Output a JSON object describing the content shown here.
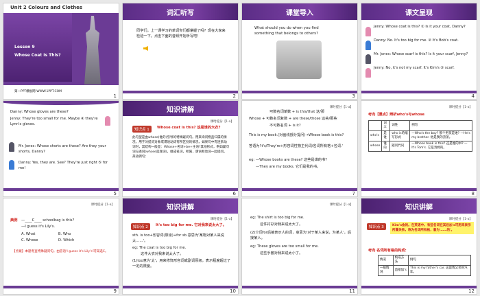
{
  "slides": [
    {
      "num": "1",
      "unit": "Unit 2 Colours and Clothes",
      "lesson": "Lesson 9",
      "title": "Whose Coat Is This?",
      "footer": "第一PPT模板网-WWW.1PPT.COM"
    },
    {
      "num": "2",
      "heading": "词汇听写",
      "body": "同学们，上一课学习的单词你们都掌握了吗？现在大家来检验一下。点击下面的音频开始听写吧！"
    },
    {
      "num": "3",
      "heading": "课堂导入",
      "body": "What should you do when you find something that belongs to others?"
    },
    {
      "num": "4",
      "heading": "课文呈现",
      "lines": [
        "Jenny: Whose coat is this? ① Is it your coat, Danny?",
        "Danny: No. It's too big for me. ② It's Bob's coat.",
        "Mr. Jones: Whose scarf is this? Is it your scarf, Jenny?",
        "Jenny: No, it's not my scarf. It's Kim's ③ scarf."
      ]
    },
    {
      "num": "5",
      "lines": [
        "Danny: Whose gloves are these?",
        "Jenny: They're too small for me. Maybe ④ they're Lynn's gloves.",
        "Mr. Jones: Whose shorts are these? Are they your shorts, Danny?",
        "Danny: Yes, they are. See? They're just right ⑤ for me!"
      ]
    },
    {
      "num": "6",
      "heading": "知识讲解",
      "tag": "课时提分【1-a】",
      "point": "知识点 1",
      "point_title": "Whose coat is this? 这是谁的大衣?",
      "body": "此句型是由whose(谁的)引导的特殊疑问句。用来询问物品归属的情况，用于对提问对象或谓语动词有所区别的情况，如果句中有连系动词时，其结构一般是：Whose+名词+be+主语?其他形式，例如疑问词与连词(whose是连词)，组成名词，所属，谓语和动词一起提问。英语例句："
    },
    {
      "num": "7",
      "tag": "课时提分【1-a】",
      "lines": [
        "可数名词单数 + is this/that 这/那",
        "Whose + 可数名词复数 + are these/those 这些/那些",
        "不可数名词 + is it?",
        "This is my book.(对画线部分提问)→Whose book is this?",
        "答语为'It's/They're+形容词性物主代词/名词所有格+名词.'",
        "eg: —Whose books are these? 这些是谁的书?",
        "—They are my books. 它们是我的书。"
      ]
    },
    {
      "num": "8",
      "tag": "课时提分【1-a】",
      "head": "考向【重点】辨析who's与whose",
      "table_headers": [
        "",
        "词义",
        "词性",
        "例句"
      ],
      "rows": [
        [
          "who's",
          "是谁",
          "who is的缩写形式",
          "—Who's the boy? 那个男孩是谁? —He's my brother. 他是我的弟弟。"
        ],
        [
          "whose",
          "谁的",
          "疑问代词",
          "—Whose book is this? 这是谁的书? —It's Tom's. 它是汤姆的。"
        ]
      ]
    },
    {
      "num": "9",
      "tag": "课时提分【1-a】",
      "eg": "典例",
      "q": "—____C____ schoolbag is this?",
      "a": "—I guess it's Lily's.",
      "options": [
        "A. What",
        "B. Who",
        "C. Whose",
        "D. Which"
      ],
      "note": "【点拨】本题考查特殊疑问句。由答语'I guess it's Lily's'可知选C。"
    },
    {
      "num": "10",
      "heading": "知识讲解",
      "tag": "课时提分【1-a】",
      "point": "知识点 2",
      "point_title": "It's too big for me. 它对我来说太大了。",
      "lines": [
        "sth. is too+形容词(原级)+for sb.意思为'某物对某人来说太……'。",
        "eg: The coat is too big for me.",
        "这件大衣对我来说太大了。",
        "(1)too意为'太'，用来修饰形容词或副词原级，表示程度超过了一定的限度。"
      ]
    },
    {
      "num": "11",
      "tag": "课时提分【1-a】",
      "lines": [
        "eg: The shirt is too big for me.",
        "这件衬衫对我来说太大了。",
        "(2)介词for后接表示人的词，意思为'对于某人来说，为某人'，后接某人。",
        "eg: These gloves are too small for me.",
        "这些手套对我来说太小了。"
      ]
    },
    {
      "num": "12",
      "heading": "知识讲解",
      "tag": "课时提分【1-a】",
      "point": "知识点 3",
      "point_title": "Kim's金的。在英语中，有些名词在其后加's可用来表示所属关系，称为名词所有格，意为'……的'。",
      "sub": "考向 名词所有格的构成:",
      "table_headers": [
        "情况",
        "构成方法",
        "例句"
      ],
      "rows": [
        [
          "一般情况",
          "直接加's",
          "This is my father's car. 这是我父亲的汽车。"
        ]
      ]
    }
  ],
  "colors": {
    "accent": "#6a3b94",
    "red": "#d0201a"
  }
}
